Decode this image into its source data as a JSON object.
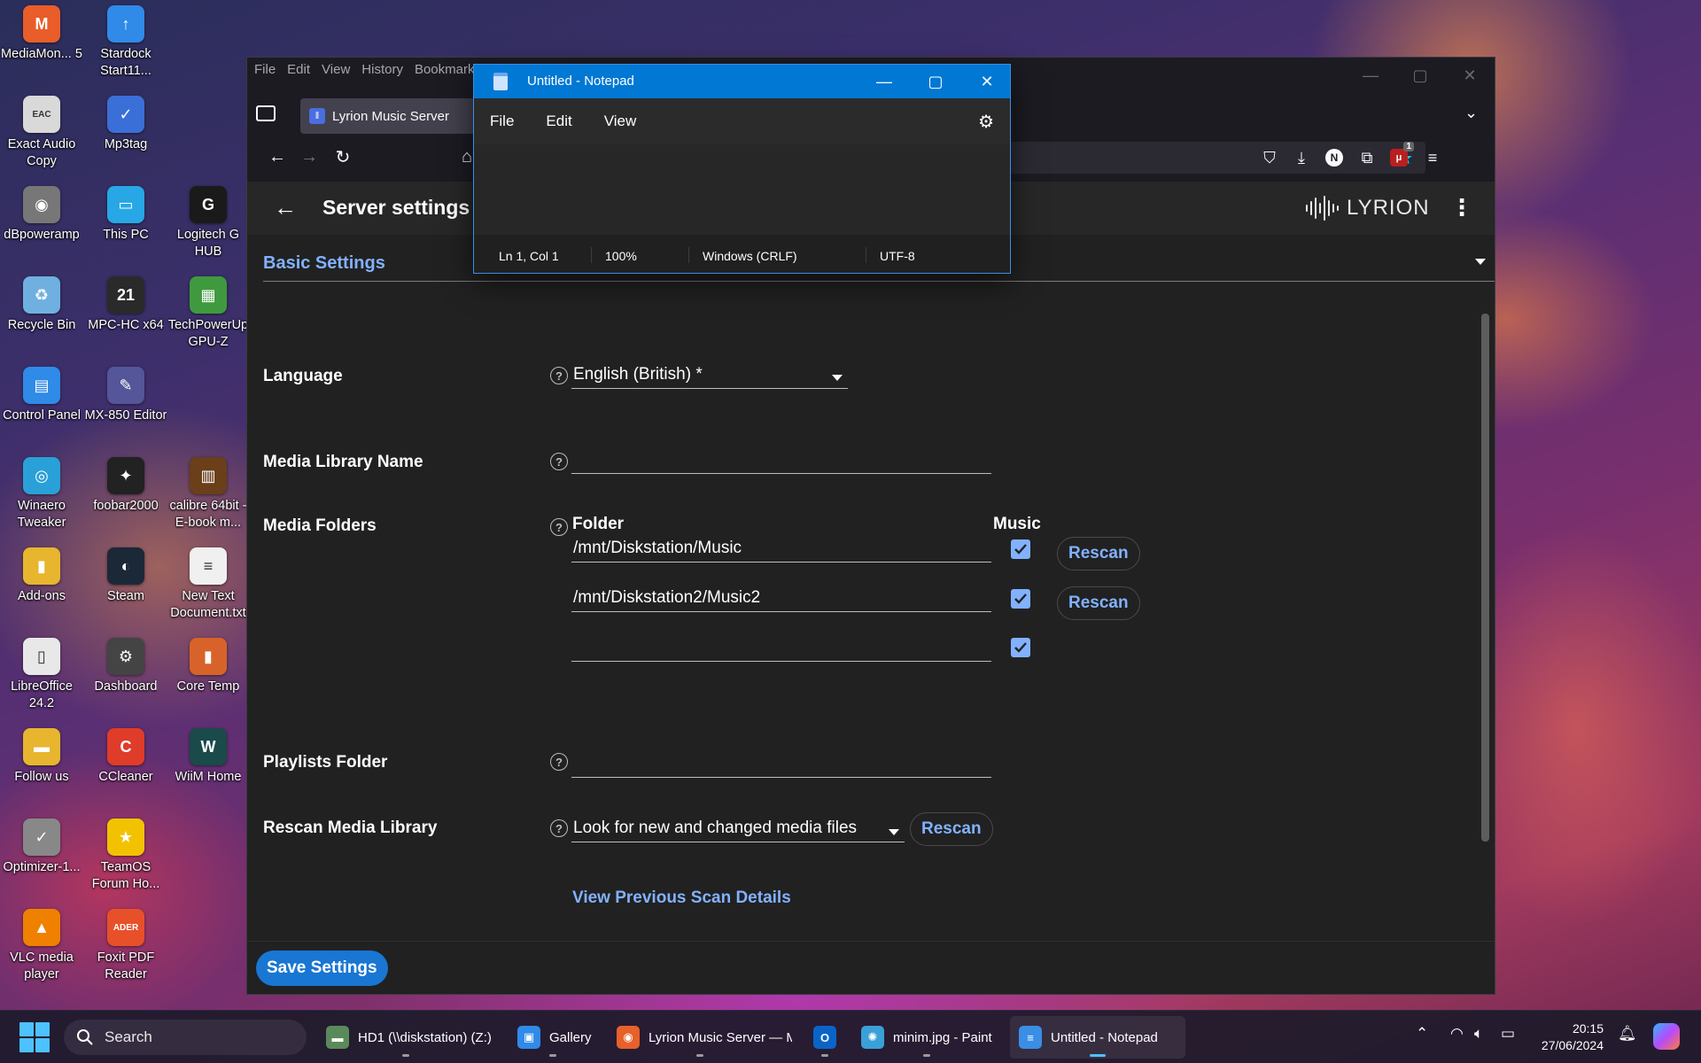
{
  "desktop": {
    "icons": [
      {
        "label": "MediaMon... 5",
        "glyph": "M",
        "color": "#e85d2a"
      },
      {
        "label": "Stardock Start11...",
        "glyph": "↑",
        "color": "#2f8ae8"
      },
      {
        "label": "Exact Audio Copy",
        "glyph": "EAC",
        "color": "#d9d9d9"
      },
      {
        "label": "Mp3tag",
        "glyph": "✓",
        "color": "#3b6fd8"
      },
      {
        "label": "dBpoweramp",
        "glyph": "◉",
        "color": "#777777"
      },
      {
        "label": "This PC",
        "glyph": "▭",
        "color": "#27a7e6"
      },
      {
        "label": "Logitech G HUB",
        "glyph": "G",
        "color": "#1a1a1a"
      },
      {
        "label": "Recycle Bin",
        "glyph": "♻",
        "color": "#6fb0e0"
      },
      {
        "label": "MPC-HC x64",
        "glyph": "21",
        "color": "#2a2a2a"
      },
      {
        "label": "TechPowerUp GPU-Z",
        "glyph": "▦",
        "color": "#3f9a3f"
      },
      {
        "label": "Control Panel",
        "glyph": "▤",
        "color": "#2f8ae8"
      },
      {
        "label": "MX-850 Editor",
        "glyph": "✎",
        "color": "#555599"
      },
      {
        "label": "Winaero Tweaker",
        "glyph": "◎",
        "color": "#2aa0d8"
      },
      {
        "label": "foobar2000",
        "glyph": "✦",
        "color": "#222222"
      },
      {
        "label": "calibre 64bit - E-book m...",
        "glyph": "▥",
        "color": "#6a3f1a"
      },
      {
        "label": "Add-ons",
        "glyph": "▮",
        "color": "#e8b52f"
      },
      {
        "label": "Steam",
        "glyph": "◐",
        "color": "#1b2838"
      },
      {
        "label": "New Text Document.txt",
        "glyph": "≡",
        "color": "#f0f0f0"
      },
      {
        "label": "LibreOffice 24.2",
        "glyph": "▯",
        "color": "#e8e8e8"
      },
      {
        "label": "Dashboard",
        "glyph": "⚙",
        "color": "#444444"
      },
      {
        "label": "Core Temp",
        "glyph": "▮",
        "color": "#d8632a"
      },
      {
        "label": "Follow us",
        "glyph": "▬",
        "color": "#e8b52f"
      },
      {
        "label": "CCleaner",
        "glyph": "C",
        "color": "#e03c2a"
      },
      {
        "label": "WiiM Home",
        "glyph": "W",
        "color": "#1a4a4a"
      },
      {
        "label": "Optimizer-1...",
        "glyph": "✓",
        "color": "#888888"
      },
      {
        "label": "TeamOS Forum Ho...",
        "glyph": "★",
        "color": "#f2c200"
      },
      {
        "label": "VLC media player",
        "glyph": "▲",
        "color": "#f08000"
      },
      {
        "label": "Foxit PDF Reader",
        "glyph": "ADER",
        "color": "#e8502a"
      }
    ]
  },
  "browser": {
    "menu": [
      "File",
      "Edit",
      "View",
      "History",
      "Bookmarks"
    ],
    "tab_title": "Lyrion Music Server",
    "extension_badge": "1",
    "profile_letter": "N"
  },
  "lyrion": {
    "page_title": "Server settings •",
    "logo_text": "LYRION",
    "section": "Basic Settings",
    "language": {
      "label": "Language",
      "value": "English (British) *"
    },
    "library_name": {
      "label": "Media Library Name",
      "value": ""
    },
    "media_folders": {
      "label": "Media Folders",
      "col_folder": "Folder",
      "col_music": "Music",
      "rows": [
        {
          "path": "/mnt/Diskstation/Music",
          "music": true,
          "action": "Rescan"
        },
        {
          "path": "/mnt/Diskstation2/Music2",
          "music": true,
          "action": "Rescan"
        },
        {
          "path": "",
          "music": true,
          "action": ""
        }
      ]
    },
    "playlists": {
      "label": "Playlists Folder",
      "value": ""
    },
    "rescan": {
      "label": "Rescan Media Library",
      "value": "Look for new and changed media files",
      "button": "Rescan"
    },
    "scan_link": "View Previous Scan Details",
    "save_button": "Save Settings"
  },
  "notepad": {
    "title": "Untitled - Notepad",
    "menu": [
      "File",
      "Edit",
      "View"
    ],
    "status": {
      "position": "Ln 1, Col 1",
      "zoom": "100%",
      "line_ending": "Windows (CRLF)",
      "encoding": "UTF-8"
    }
  },
  "taskbar": {
    "search_placeholder": "Search",
    "apps": [
      {
        "label": "HD1 (\\\\diskstation) (Z:)",
        "glyph": "▬",
        "color": "#5a8a5a",
        "active": false
      },
      {
        "label": "Gallery",
        "glyph": "▣",
        "color": "#2f8ae8",
        "active": false
      },
      {
        "label": "Lyrion Music Server — M",
        "glyph": "◉",
        "color": "#e8602a",
        "active": false
      },
      {
        "label": "",
        "glyph": "O",
        "color": "#0a64c8",
        "active": false
      },
      {
        "label": "minim.jpg - Paint",
        "glyph": "✺",
        "color": "#3aa0d8",
        "active": false
      },
      {
        "label": "Untitled - Notepad",
        "glyph": "≡",
        "color": "#3a8ee6",
        "active": true
      }
    ],
    "time": "20:15",
    "date": "27/06/2024"
  }
}
